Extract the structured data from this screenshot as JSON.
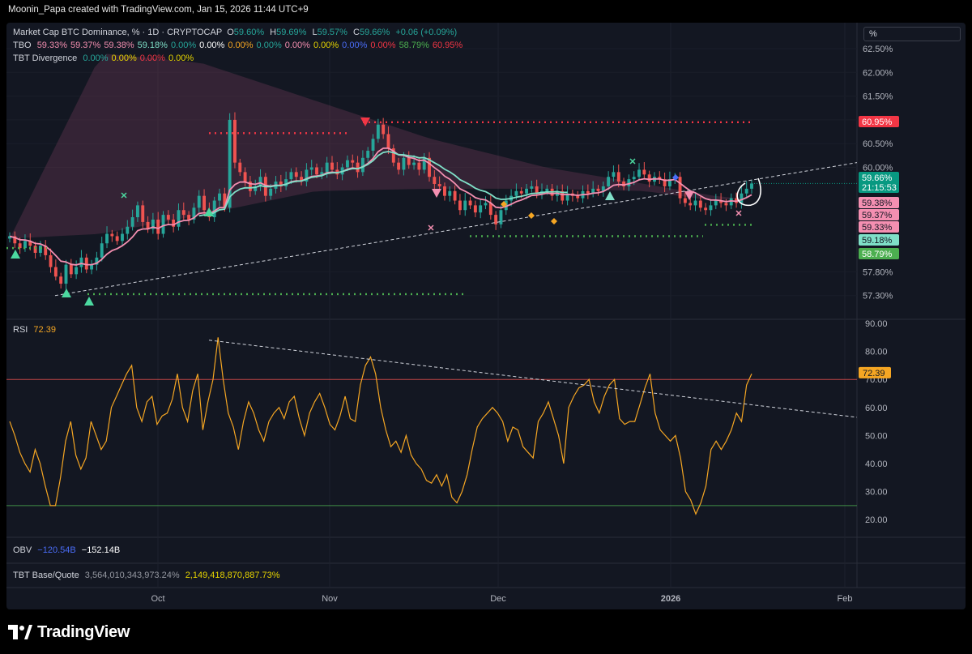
{
  "header": {
    "text": "Moonin_Papa created with TradingView.com, Jan 15, 2026 11:44 UTC+9"
  },
  "legend": {
    "main": {
      "title": "Market Cap BTC Dominance, % · 1D · CRYPTOCAP",
      "o_label": "O",
      "o": "59.60%",
      "h_label": "H",
      "h": "59.69%",
      "l_label": "L",
      "l": "59.57%",
      "c_label": "C",
      "c": "59.66%",
      "change": "+0.06 (+0.09%)"
    },
    "tbo": {
      "label": "TBO",
      "values": [
        {
          "v": "59.33%",
          "color": "#f48fb1"
        },
        {
          "v": "59.37%",
          "color": "#f48fb1"
        },
        {
          "v": "59.38%",
          "color": "#f48fb1"
        },
        {
          "v": "59.18%",
          "color": "#7fe0c8"
        },
        {
          "v": "0.00%",
          "color": "#26a69a"
        },
        {
          "v": "0.00%",
          "color": "#ffffff"
        },
        {
          "v": "0.00%",
          "color": "#f5a623"
        },
        {
          "v": "0.00%",
          "color": "#26a69a"
        },
        {
          "v": "0.00%",
          "color": "#f48fb1"
        },
        {
          "v": "0.00%",
          "color": "#e6d400"
        },
        {
          "v": "0.00%",
          "color": "#4a6cf7"
        },
        {
          "v": "0.00%",
          "color": "#f23645"
        },
        {
          "v": "58.79%",
          "color": "#4caf50"
        },
        {
          "v": "60.95%",
          "color": "#f23645"
        }
      ]
    },
    "div": {
      "label": "TBT Divergence",
      "values": [
        {
          "v": "0.00%",
          "color": "#26a69a"
        },
        {
          "v": "0.00%",
          "color": "#e6d400"
        },
        {
          "v": "0.00%",
          "color": "#f23645"
        },
        {
          "v": "0.00%",
          "color": "#e6d400"
        }
      ]
    },
    "rsi": {
      "label": "RSI",
      "value": "72.39"
    },
    "obv": {
      "label": "OBV",
      "v1": "−120.54B",
      "v2": "−152.14B"
    },
    "basequote": {
      "label": "TBT Base/Quote",
      "v1": "3,564,010,343,973.24%",
      "v2": "2,149,418,870,887.73%"
    }
  },
  "scale_box": {
    "label": "%"
  },
  "price_tags": [
    {
      "text": "60.95%",
      "value": 60.95,
      "bg": "#f23645",
      "fg": "#ffffff"
    },
    {
      "text": "59.66%",
      "value": 59.66,
      "bg": "#089981",
      "fg": "#ffffff",
      "sub": "21:15:53"
    },
    {
      "text": "59.38%",
      "value": 59.38,
      "bg": "#f48fb1",
      "fg": "#131722"
    },
    {
      "text": "59.37%",
      "value": 59.37,
      "bg": "#f48fb1",
      "fg": "#131722"
    },
    {
      "text": "59.33%",
      "value": 59.33,
      "bg": "#f48fb1",
      "fg": "#131722"
    },
    {
      "text": "59.18%",
      "value": 59.18,
      "bg": "#7fe0c8",
      "fg": "#131722"
    },
    {
      "text": "58.79%",
      "value": 58.79,
      "bg": "#4caf50",
      "fg": "#ffffff"
    }
  ],
  "rsi_tag": {
    "text": "72.39",
    "value": 72.39,
    "bg": "#f5a623",
    "fg": "#131722"
  },
  "footer": {
    "brand": "TradingView"
  },
  "chart_data": [
    {
      "type": "candlestick",
      "title": "Market Cap BTC Dominance, % · 1D · CRYPTOCAP",
      "x_labels": [
        "Oct",
        "Nov",
        "Dec",
        "2026",
        "Feb"
      ],
      "y_ticks": [
        "62.50%",
        "62.00%",
        "61.50%",
        "61.00%",
        "60.50%",
        "60.00%",
        "57.80%",
        "57.30%"
      ],
      "y_tick_values": [
        62.5,
        62.0,
        61.5,
        61.0,
        60.5,
        60.0,
        57.8,
        57.3
      ],
      "ylim": [
        57.1,
        63.0
      ],
      "close": [
        58.55,
        58.4,
        58.3,
        58.45,
        58.35,
        58.2,
        58.35,
        58.15,
        57.9,
        57.7,
        57.55,
        57.95,
        57.75,
        57.9,
        58.1,
        57.85,
        57.95,
        58.1,
        58.4,
        58.6,
        58.55,
        58.45,
        58.6,
        58.75,
        58.95,
        59.2,
        58.85,
        58.7,
        58.9,
        58.6,
        59.0,
        58.9,
        58.75,
        59.1,
        59.0,
        58.9,
        59.15,
        59.4,
        59.1,
        58.95,
        59.3,
        59.45,
        59.15,
        61.0,
        60.1,
        59.9,
        59.7,
        59.5,
        59.6,
        59.8,
        59.4,
        59.55,
        59.7,
        59.6,
        59.75,
        59.9,
        59.8,
        59.7,
        59.95,
        60.0,
        59.85,
        59.9,
        60.1,
        59.95,
        59.85,
        60.0,
        60.15,
        60.1,
        59.9,
        60.2,
        60.35,
        60.6,
        60.9,
        60.7,
        60.4,
        60.1,
        59.95,
        60.2,
        60.05,
        60.1,
        59.95,
        60.2,
        59.8,
        59.65,
        59.6,
        59.4,
        59.5,
        59.3,
        59.1,
        59.3,
        59.2,
        59.05,
        59.2,
        59.25,
        59.0,
        58.8,
        59.1,
        59.3,
        59.4,
        59.5,
        59.45,
        59.55,
        59.6,
        59.45,
        59.5,
        59.55,
        59.4,
        59.5,
        59.3,
        59.45,
        59.4,
        59.35,
        59.5,
        59.45,
        59.55,
        59.5,
        59.6,
        59.8,
        59.9,
        59.7,
        59.6,
        59.75,
        59.8,
        59.95,
        59.85,
        59.7,
        59.8,
        59.75,
        59.6,
        59.75,
        59.8,
        59.35,
        59.25,
        59.2,
        59.3,
        59.15,
        59.1,
        59.2,
        59.3,
        59.25,
        59.2,
        59.35,
        59.25,
        59.45,
        59.55,
        59.66
      ]
    },
    {
      "type": "line",
      "title": "RSI",
      "y_ticks": [
        "90.00",
        "80.00",
        "70.00",
        "60.00",
        "50.00",
        "40.00",
        "30.00",
        "20.00"
      ],
      "y_tick_values": [
        90,
        80,
        70,
        60,
        50,
        40,
        30,
        20
      ],
      "ylim": [
        16,
        92
      ],
      "levels": [
        70,
        25
      ],
      "values": [
        55,
        50,
        44,
        40,
        37,
        45,
        40,
        32,
        25,
        25,
        35,
        48,
        55,
        43,
        38,
        42,
        55,
        50,
        45,
        48,
        60,
        64,
        68,
        72,
        75,
        60,
        55,
        62,
        64,
        54,
        57,
        58,
        63,
        72,
        60,
        55,
        66,
        72,
        52,
        62,
        70,
        85,
        70,
        58,
        53,
        45,
        55,
        62,
        58,
        52,
        48,
        55,
        58,
        60,
        56,
        62,
        64,
        56,
        50,
        58,
        62,
        65,
        60,
        54,
        52,
        57,
        64,
        56,
        55,
        68,
        75,
        78,
        72,
        60,
        52,
        46,
        48,
        44,
        50,
        43,
        40,
        38,
        34,
        33,
        36,
        32,
        36,
        28,
        26,
        30,
        36,
        45,
        53,
        56,
        58,
        60,
        58,
        55,
        48,
        53,
        52,
        46,
        44,
        42,
        55,
        58,
        62,
        56,
        50,
        40,
        60,
        64,
        67,
        68,
        70,
        62,
        58,
        64,
        68,
        70,
        56,
        54,
        55,
        55,
        61,
        67,
        72,
        58,
        52,
        50,
        48,
        50,
        42,
        30,
        27,
        22,
        26,
        32,
        45,
        48,
        45,
        48,
        52,
        58,
        55,
        68,
        72
      ]
    }
  ]
}
